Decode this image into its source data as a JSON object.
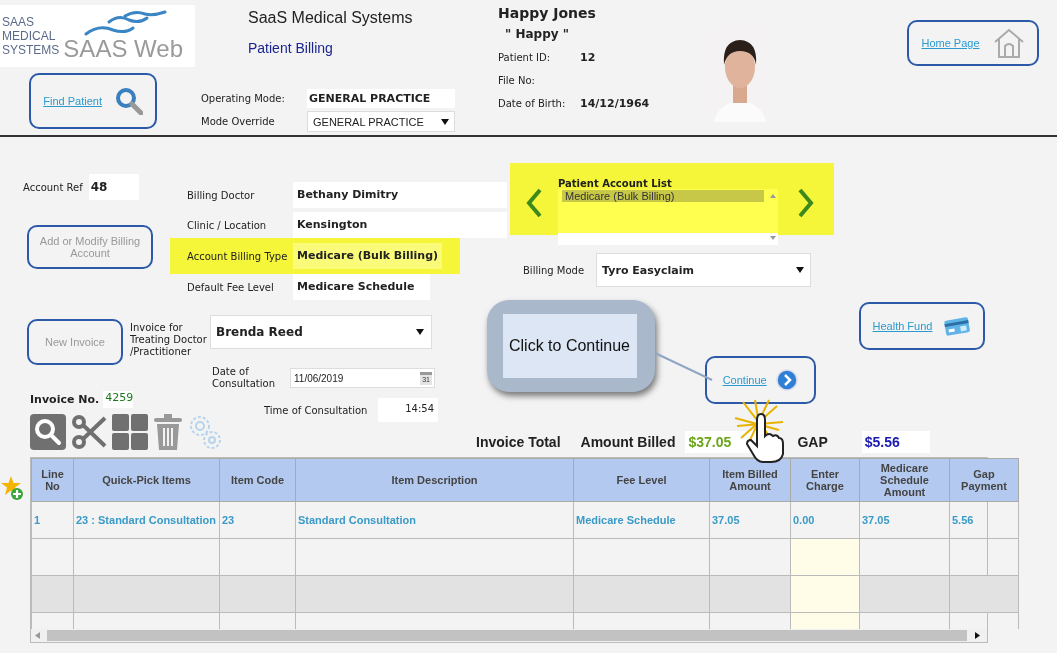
{
  "header": {
    "logo_lines": [
      "SAAS",
      "MEDICAL",
      "SYSTEMS"
    ],
    "logo_wordmark": "SAAS Web",
    "app_title": "SaaS Medical Systems",
    "page_title": "Patient Billing",
    "find_patient_button": "Find Patient",
    "mode_fields": [
      {
        "kind": "text",
        "label": "Operating Mode:",
        "value": "GENERAL PRACTICE"
      },
      {
        "kind": "select",
        "label": "Mode Override",
        "value": "GENERAL PRACTICE"
      }
    ]
  },
  "patient": {
    "name": "Happy Jones",
    "nickname": "\" Happy \"",
    "fields": [
      {
        "label": "Patient ID:",
        "value": "12"
      },
      {
        "label": "File No:"
      },
      {
        "label": "Date of Birth:",
        "value": "14/12/1964"
      }
    ]
  },
  "home_button": "Home Page",
  "account": {
    "ref_label": "Account Ref",
    "ref": "48",
    "add_modify_button": "Add or Modify Billing Account",
    "fields": [
      {
        "label": "Billing Doctor",
        "value": "Bethany Dimitry",
        "highlighted": false
      },
      {
        "label": "Clinic / Location",
        "value": "Kensington",
        "highlighted": false
      },
      {
        "label": "Account Billing Type",
        "value": "Medicare (Bulk Billing)",
        "highlighted": true
      },
      {
        "label": "Default Fee Level",
        "value": "Medicare Schedule",
        "highlighted": false
      }
    ]
  },
  "account_list": {
    "label": "Patient Account List",
    "highlighted": true,
    "items": [
      {
        "label": "Medicare (Bulk Billing)",
        "selected": true
      }
    ]
  },
  "billing_mode": {
    "label": "Billing Mode",
    "value": "Tyro Easyclaim"
  },
  "invoice": {
    "new_invoice_button": "New Invoice",
    "number_label": "Invoice No.",
    "number": "4259",
    "doctor_label": "Invoice for Treating Doctor /Practitioner",
    "doctor": "Brenda Reed",
    "date_label": "Date of Consultation",
    "date": "11/06/2019",
    "calendar_day": "31",
    "time_label": "Time of Consultation",
    "time": "14:54"
  },
  "callout": "Click to Continue",
  "continue_button": "Continue",
  "health_fund_button": "Health Fund",
  "totals": {
    "invoice_total": "Invoice Total",
    "amount_billed_label": "Amount Billed",
    "amount_billed": "$37.05",
    "gap_label": "GAP",
    "gap": "$5.56"
  },
  "table": {
    "columns": [
      "Line No",
      "Quick-Pick Items",
      "Item Code",
      "Item Description",
      "Fee Level",
      "Item Billed Amount",
      "Enter Charge",
      "Medicare Schedule Amount",
      "Gap Payment"
    ],
    "rows": [
      {
        "cells": [
          "1",
          "23 : Standard Consultation",
          "23",
          "Standard Consultation",
          "Medicare Schedule",
          "37.05",
          "0.00",
          "37.05",
          "5.56"
        ]
      }
    ]
  }
}
